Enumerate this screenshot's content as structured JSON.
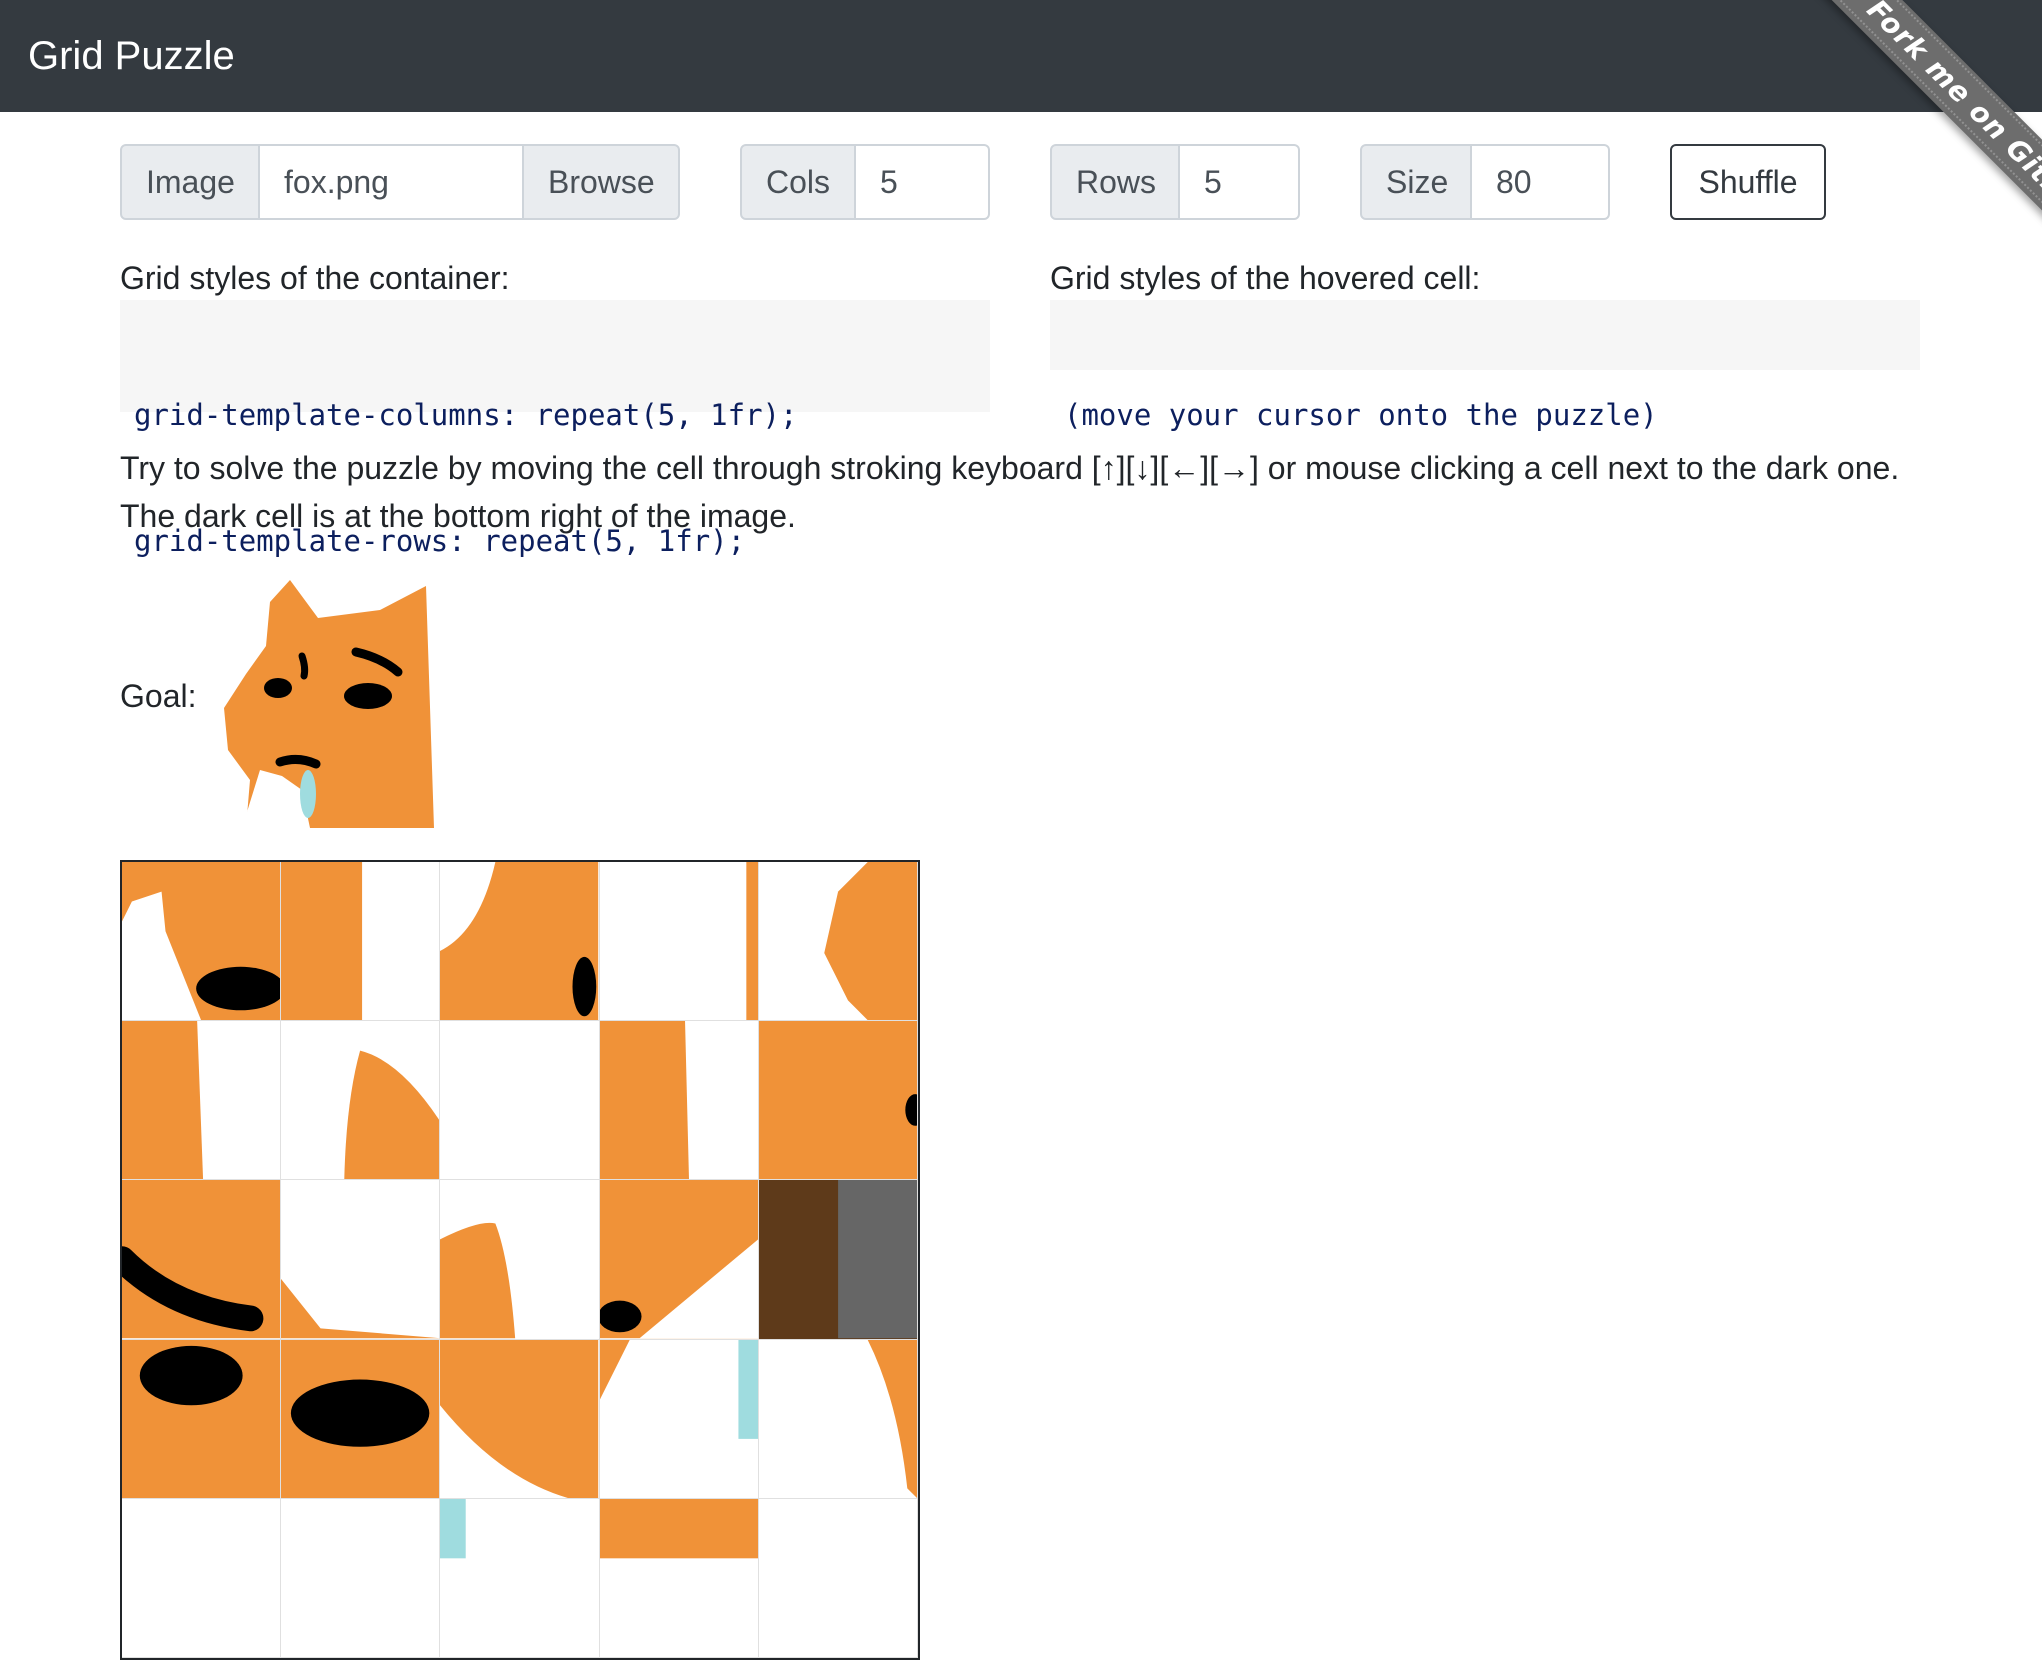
{
  "navbar": {
    "title": "Grid Puzzle"
  },
  "ribbon": {
    "label": "Fork me on GitHub"
  },
  "controls": {
    "image_label": "Image",
    "image_value": "fox.png",
    "browse_label": "Browse",
    "cols_label": "Cols",
    "cols_value": "5",
    "rows_label": "Rows",
    "rows_value": "5",
    "size_label": "Size",
    "size_value": "80",
    "shuffle_label": "Shuffle"
  },
  "container_styles": {
    "heading": "Grid styles of the container:",
    "lines": [
      "grid-template-columns: repeat(5, 1fr);",
      "grid-template-rows: repeat(5, 1fr);"
    ]
  },
  "hovered_styles": {
    "heading": "Grid styles of the hovered cell:",
    "text": "(move your cursor onto the puzzle)"
  },
  "instructions": "Try to solve the puzzle by moving the cell through stroking keyboard [↑][↓][←][→] or mouse clicking a cell next to the dark one. The dark cell is at the bottom right of the image.",
  "goal": {
    "label": "Goal:"
  },
  "colors": {
    "navbar": "#343a40",
    "fox_orange": "#f09238",
    "dark_cell": "#5e3a1a"
  },
  "puzzle": {
    "cols": 5,
    "rows": 5,
    "dark_cell": {
      "row": 3,
      "col": 5
    }
  }
}
